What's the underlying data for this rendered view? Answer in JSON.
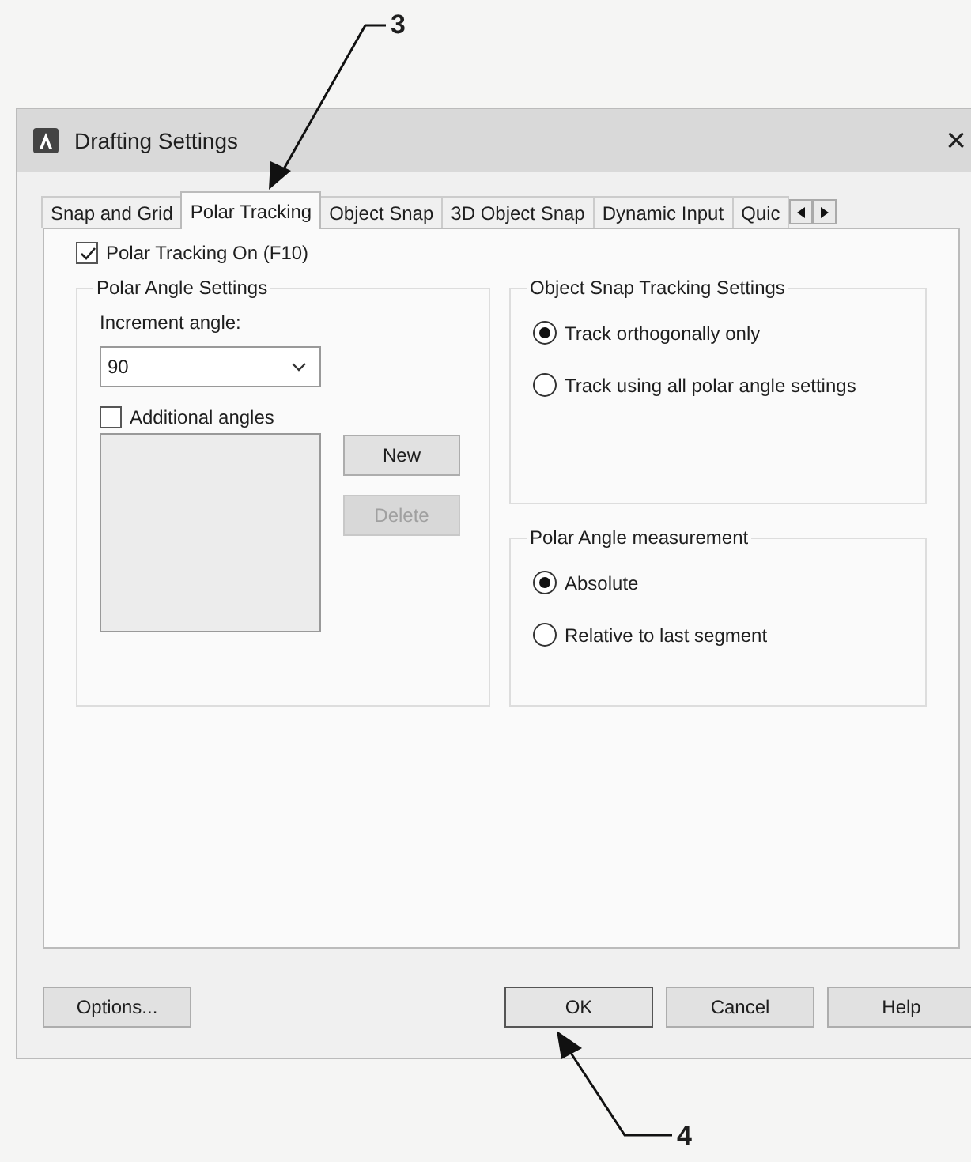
{
  "callouts": [
    {
      "number": "3"
    },
    {
      "number": "4"
    }
  ],
  "window": {
    "title": "Drafting Settings",
    "close": "×"
  },
  "tabs": [
    {
      "label": "Snap and Grid",
      "selected": false
    },
    {
      "label": "Polar Tracking",
      "selected": true
    },
    {
      "label": "Object Snap",
      "selected": false
    },
    {
      "label": "3D Object Snap",
      "selected": false
    },
    {
      "label": "Dynamic Input",
      "selected": false
    },
    {
      "label": "Quic",
      "selected": false
    }
  ],
  "polar_tracking_on": {
    "label": "Polar Tracking On (F10)",
    "checked": true
  },
  "polar_angle_settings": {
    "title": "Polar Angle Settings",
    "increment_label": "Increment angle:",
    "increment_value": "90",
    "additional_angles": {
      "label": "Additional angles",
      "checked": false
    },
    "buttons": [
      {
        "label": "New",
        "disabled": false
      },
      {
        "label": "Delete",
        "disabled": true
      }
    ]
  },
  "object_snap_tracking": {
    "title": "Object Snap Tracking Settings",
    "options": [
      {
        "label": "Track orthogonally only",
        "selected": true
      },
      {
        "label": "Track using all polar angle settings",
        "selected": false
      }
    ]
  },
  "polar_angle_measurement": {
    "title": "Polar Angle measurement",
    "options": [
      {
        "label": "Absolute",
        "selected": true
      },
      {
        "label": "Relative to last segment",
        "selected": false
      }
    ]
  },
  "footer_buttons": [
    {
      "label": "Options...",
      "default": false
    },
    {
      "label": "OK",
      "default": true
    },
    {
      "label": "Cancel",
      "default": false
    },
    {
      "label": "Help",
      "default": false
    }
  ]
}
